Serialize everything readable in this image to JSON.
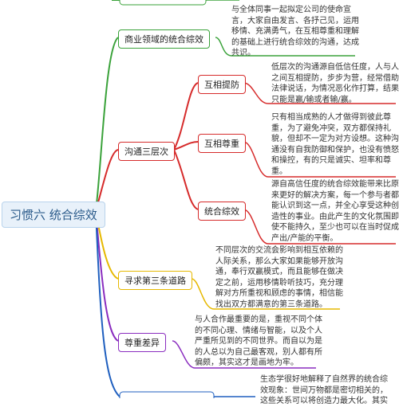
{
  "center": {
    "label": "习惯六 统合综效"
  },
  "branches": [
    {
      "label": "商业领域的统合综效",
      "color": "#3aa23a",
      "note": "与全体同事一起拟定公司的使命宣\n言，大家自由发言、各抒己见，运用\n移情、充满勇气，在互相尊重和理解\n的基础上进行统合综效的沟通，达成\n共识。"
    },
    {
      "label": "沟通三层次",
      "color": "#d62b2b",
      "children": [
        {
          "label": "互相提防",
          "note": "低层次的沟通源自低信任度，人与人\n之间互相提防，步步为营，经常借助\n法律说话，为情况恶化作打算，结果\n只能是赢/输或者输/赢。"
        },
        {
          "label": "互相尊重",
          "note": "只有相当成熟的人才做得到彼此尊\n重，为了避免冲突，双方都保持礼\n貌，但却不一定为对方设想。这种沟\n通没有自我防御和保护，也没有愤怒\n和操控，有的只是诚实、坦率和尊\n重。"
        },
        {
          "label": "统合综效",
          "note": "源自高信任度的统合综效能带来比原\n来更好的解决方案，每一个参与者都\n能认识到这一点，并全心享受这种创\n造性的事业。由此产生的文化氛围即\n使不能持久，至少也可以在当时促成\n产出/产能的平衡。"
        }
      ]
    },
    {
      "label": "寻求第三条道路",
      "color": "#e6b800",
      "note": "不同层次的交流会影响到相互依赖的\n人际关系，那么大家如果能够开放沟\n通，奉行双赢模式，而且能够在做决\n定之前，运用移情聆听技巧，充分理\n解对方所重视和顾虑的事情，相信能\n找出双方都满意的第三条道路。"
    },
    {
      "label": "尊重差异",
      "color": "#8a2dbf",
      "note": "与人合作最重要的是，重视不同个体\n的不同心理、情绪与智能，以及个人\n严重所见到的不同世界。而自以为是\n的人总以为自己最客观，别人都有所\n偏颇，其实这才是画地为牢。"
    },
    {
      "color": "#1f5fbf",
      "note": "生态学很好地解释了自然界的统合综\n效现象：世间万物都是密切相关的，\n这些关系可以将创造力最大化。其实"
    }
  ]
}
